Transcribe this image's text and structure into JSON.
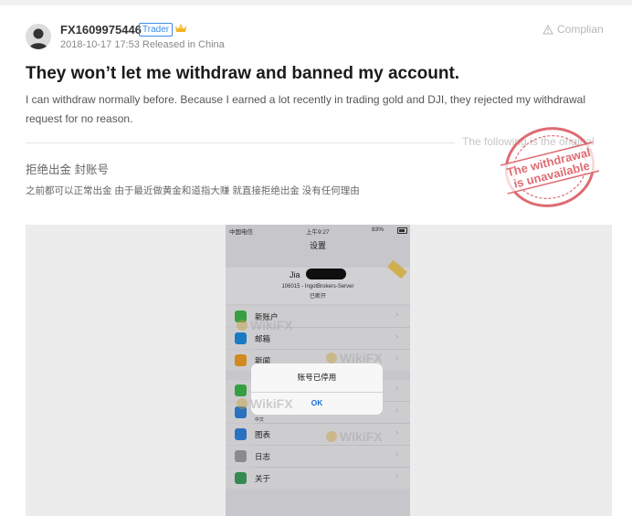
{
  "post": {
    "username": "FX1609975446",
    "badge": "Trader",
    "meta": "2018-10-17 17:53 Released in China",
    "complain_label": "Complian",
    "title": "They won’t let me withdraw and banned my account.",
    "body_en": "I can withdraw normally before. Because I earned a lot recently in trading gold and DJI, they rejected my withdrawal request for no reason.",
    "following_label": "The following is the original",
    "title_cn": "拒绝出金 封账号",
    "body_cn": "之前都可以正常出金 由于最近做黄金和道指大赚 就直接拒绝出金 没有任何理由"
  },
  "stamp": {
    "line1": "The withdrawal",
    "line2": "is unavailable",
    "color": "#d9535b"
  },
  "phone": {
    "status_carrier": "中国电信",
    "status_time": "上午9:27",
    "status_battery": "83%",
    "nav_title": "设置",
    "account_name": "Jia",
    "account_server": "106015 - IngotBrokers-Server",
    "account_status": "已断开",
    "menu": [
      {
        "label": "新账户",
        "icon": "new-account-icon",
        "color": "#3db24a"
      },
      {
        "label": "邮箱",
        "icon": "mailbox-icon",
        "color": "#1e88d8"
      },
      {
        "label": "新闻",
        "icon": "news-icon",
        "color": "#e89a23"
      },
      {
        "label": "",
        "icon": "lock-icon",
        "color": "#3db24a"
      },
      {
        "label": "中文",
        "icon": "language-icon",
        "color": "#2f7fd6"
      },
      {
        "label": "图表",
        "icon": "charts-icon",
        "color": "#2f7fd6"
      },
      {
        "label": "日志",
        "icon": "journal-icon",
        "color": "#9a9aa0"
      },
      {
        "label": "关于",
        "icon": "about-icon",
        "color": "#3a9a5a"
      }
    ],
    "dialog": {
      "title": "账号已停用",
      "ok": "OK"
    }
  },
  "watermark": "WikiFX",
  "colors": {
    "badge_blue": "#3a8be8",
    "dialog_ok": "#1a6fd8"
  }
}
